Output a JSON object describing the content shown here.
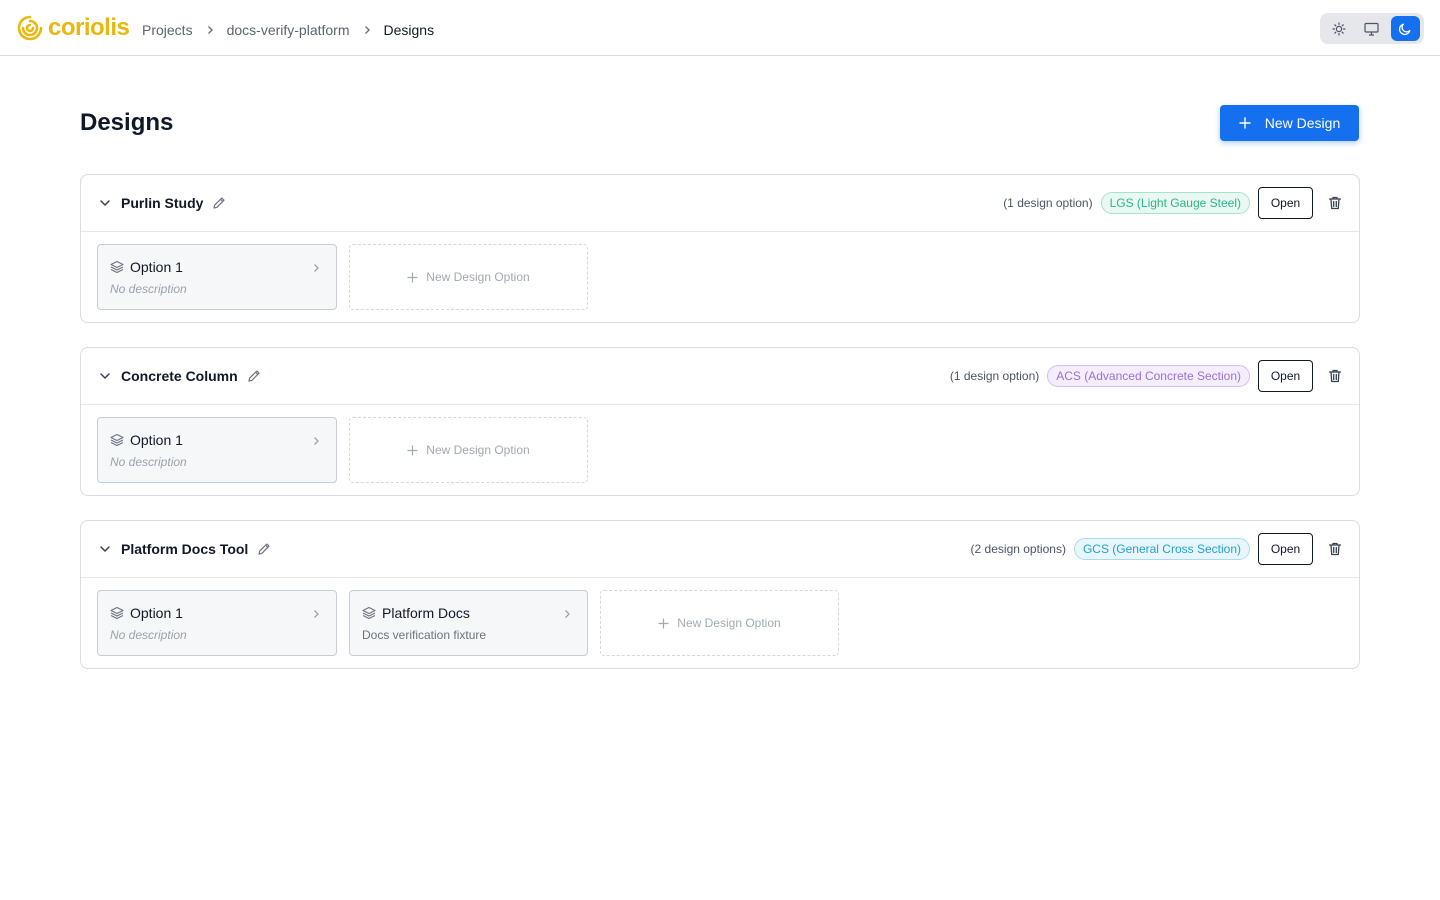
{
  "header": {
    "logo_text": "coriolis",
    "breadcrumbs": [
      "Projects",
      "docs-verify-platform",
      "Designs"
    ],
    "theme_options": [
      "light",
      "system",
      "dark"
    ],
    "active_theme": "dark"
  },
  "page": {
    "title": "Designs",
    "new_design_label": "New Design"
  },
  "designs": [
    {
      "name": "Purlin Study",
      "option_count_text": "(1 design option)",
      "badge": "LGS (Light Gauge Steel)",
      "badge_color": "#2bb58a",
      "open_label": "Open",
      "options": [
        {
          "name": "Option 1",
          "description": "No description"
        }
      ],
      "new_option_label": "New Design Option"
    },
    {
      "name": "Concrete Column",
      "option_count_text": "(1 design option)",
      "badge": "ACS (Advanced Concrete Section)",
      "badge_color": "#9b6fd6",
      "open_label": "Open",
      "options": [
        {
          "name": "Option 1",
          "description": "No description"
        }
      ],
      "new_option_label": "New Design Option"
    },
    {
      "name": "Platform Docs Tool",
      "option_count_text": "(2 design options)",
      "badge": "GCS (General Cross Section)",
      "badge_color": "#1fa3cf",
      "open_label": "Open",
      "options": [
        {
          "name": "Option 1",
          "description": "No description"
        },
        {
          "name": "Platform Docs",
          "description": "Docs verification fixture"
        }
      ],
      "new_option_label": "New Design Option"
    }
  ],
  "colors": {
    "primary": "#1570ef",
    "logo": "#e8b710"
  }
}
